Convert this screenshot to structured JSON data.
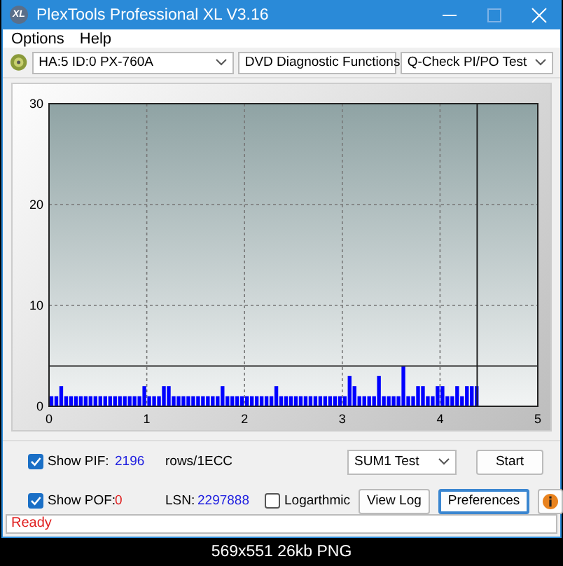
{
  "window": {
    "icon_label": "XL",
    "title": "PlexTools Professional XL V3.16"
  },
  "menu": [
    "Options",
    "Help"
  ],
  "toolbar": {
    "drive": "HA:5 ID:0  PX-760A",
    "function": "DVD Diagnostic Functions",
    "test": "Q-Check PI/PO Test"
  },
  "chart": {
    "chart_data": {
      "type": "bar",
      "xlim": [
        0,
        5
      ],
      "ylim": [
        0,
        30
      ],
      "xticks": [
        0,
        1,
        2,
        3,
        4,
        5
      ],
      "yticks": [
        0,
        10,
        20,
        30
      ],
      "x": [
        0,
        0.05,
        0.1,
        0.15,
        0.2,
        0.25,
        0.3,
        0.35,
        0.4,
        0.45,
        0.5,
        0.55,
        0.6,
        0.65,
        0.7,
        0.75,
        0.8,
        0.85,
        0.9,
        0.95,
        1,
        1.05,
        1.1,
        1.15,
        1.2,
        1.25,
        1.3,
        1.35,
        1.4,
        1.45,
        1.5,
        1.55,
        1.6,
        1.65,
        1.7,
        1.75,
        1.8,
        1.85,
        1.9,
        1.95,
        2,
        2.05,
        2.1,
        2.15,
        2.2,
        2.25,
        2.3,
        2.35,
        2.4,
        2.45,
        2.5,
        2.55,
        2.6,
        2.65,
        2.7,
        2.75,
        2.8,
        2.85,
        2.9,
        2.95,
        3,
        3.05,
        3.1,
        3.15,
        3.2,
        3.25,
        3.3,
        3.35,
        3.4,
        3.45,
        3.5,
        3.55,
        3.6,
        3.65,
        3.7,
        3.75,
        3.8,
        3.85,
        3.9,
        3.95,
        4,
        4.05,
        4.1,
        4.15,
        4.2,
        4.25,
        4.3,
        4.35
      ],
      "series": [
        {
          "color": "#0000ff",
          "values": [
            1,
            1,
            2,
            1,
            1,
            1,
            1,
            1,
            1,
            1,
            1,
            1,
            1,
            1,
            1,
            1,
            1,
            1,
            1,
            2,
            1,
            1,
            1,
            2,
            2,
            1,
            1,
            1,
            1,
            1,
            1,
            1,
            1,
            1,
            1,
            2,
            1,
            1,
            1,
            1,
            1,
            1,
            1,
            1,
            1,
            1,
            2,
            1,
            1,
            1,
            1,
            1,
            1,
            1,
            1,
            1,
            1,
            1,
            1,
            1,
            1,
            3,
            2,
            1,
            1,
            1,
            1,
            3,
            1,
            1,
            1,
            1,
            4,
            1,
            1,
            2,
            2,
            1,
            1,
            2,
            2,
            1,
            1,
            2,
            1,
            2,
            2,
            2
          ]
        }
      ],
      "grid": true,
      "ref_lines": [
        {
          "axis": "y",
          "value": 4
        },
        {
          "axis": "x",
          "value": 4.38
        }
      ]
    }
  },
  "controls": {
    "show_pif": {
      "label": "Show PIF:",
      "checked": true,
      "value": "2196",
      "unit": "rows/1ECC"
    },
    "show_pof": {
      "label": "Show POF:",
      "checked": true,
      "value": "0"
    },
    "lsn_label": "LSN:",
    "lsn_value": "2297888",
    "logarithmic": {
      "label": "Logarthmic",
      "checked": false
    },
    "mode": "SUM1 Test",
    "buttons": [
      {
        "label": "Start",
        "focused": false
      },
      {
        "label": "View Log",
        "focused": false
      },
      {
        "label": "Preferences",
        "focused": true
      }
    ]
  },
  "status_bar": "Ready",
  "caption": "569x551 26kb PNG"
}
